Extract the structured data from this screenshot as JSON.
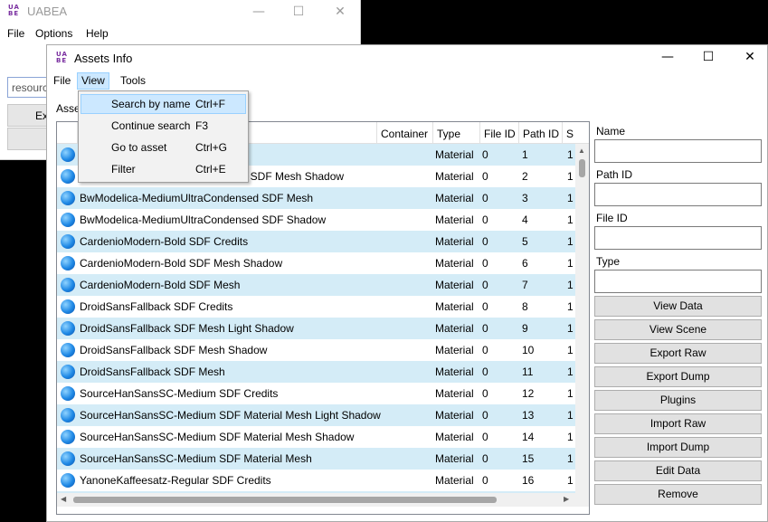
{
  "bg_window": {
    "title": "UABEA",
    "logo": "UA BE",
    "menu": [
      "File",
      "Options",
      "Help"
    ],
    "input_value": "resourc",
    "buttons": [
      "Ex",
      ""
    ],
    "min_icon": "—",
    "max_icon": "☐",
    "close_icon": "✕"
  },
  "window": {
    "title": "Assets Info",
    "logo": "UA BE",
    "min_icon": "—",
    "max_icon": "☐",
    "close_icon": "✕",
    "menu": {
      "file": "File",
      "view": "View",
      "tools": "Tools"
    },
    "assets_label": "Asse"
  },
  "view_menu": {
    "items": [
      {
        "label": "Search by name",
        "shortcut": "Ctrl+F"
      },
      {
        "label": "Continue search",
        "shortcut": "F3"
      },
      {
        "label": "Go to asset",
        "shortcut": "Ctrl+G"
      },
      {
        "label": "Filter",
        "shortcut": "Ctrl+E"
      }
    ]
  },
  "table": {
    "columns": {
      "container": "Container",
      "type": "Type",
      "file_id": "File ID",
      "path_id": "Path ID",
      "size": "S"
    },
    "rows": [
      {
        "name": "",
        "type": "Material",
        "file_id": "0",
        "path_id": "1",
        "size": "1"
      },
      {
        "name": "ed SDF Mesh Shadow",
        "type": "Material",
        "file_id": "0",
        "path_id": "2",
        "size": "1"
      },
      {
        "name": "BwModelica-MediumUltraCondensed SDF Mesh",
        "type": "Material",
        "file_id": "0",
        "path_id": "3",
        "size": "1"
      },
      {
        "name": "BwModelica-MediumUltraCondensed SDF Shadow",
        "type": "Material",
        "file_id": "0",
        "path_id": "4",
        "size": "1"
      },
      {
        "name": "CardenioModern-Bold SDF Credits",
        "type": "Material",
        "file_id": "0",
        "path_id": "5",
        "size": "1"
      },
      {
        "name": "CardenioModern-Bold SDF Mesh Shadow",
        "type": "Material",
        "file_id": "0",
        "path_id": "6",
        "size": "1"
      },
      {
        "name": "CardenioModern-Bold SDF Mesh",
        "type": "Material",
        "file_id": "0",
        "path_id": "7",
        "size": "1"
      },
      {
        "name": "DroidSansFallback SDF Credits",
        "type": "Material",
        "file_id": "0",
        "path_id": "8",
        "size": "1"
      },
      {
        "name": "DroidSansFallback SDF Mesh Light Shadow",
        "type": "Material",
        "file_id": "0",
        "path_id": "9",
        "size": "1"
      },
      {
        "name": "DroidSansFallback SDF Mesh Shadow",
        "type": "Material",
        "file_id": "0",
        "path_id": "10",
        "size": "1"
      },
      {
        "name": "DroidSansFallback SDF Mesh",
        "type": "Material",
        "file_id": "0",
        "path_id": "11",
        "size": "1"
      },
      {
        "name": "SourceHanSansSC-Medium SDF Credits",
        "type": "Material",
        "file_id": "0",
        "path_id": "12",
        "size": "1"
      },
      {
        "name": "SourceHanSansSC-Medium SDF Material Mesh Light Shadow",
        "type": "Material",
        "file_id": "0",
        "path_id": "13",
        "size": "1"
      },
      {
        "name": "SourceHanSansSC-Medium SDF Material Mesh Shadow",
        "type": "Material",
        "file_id": "0",
        "path_id": "14",
        "size": "1"
      },
      {
        "name": "SourceHanSansSC-Medium SDF Material Mesh",
        "type": "Material",
        "file_id": "0",
        "path_id": "15",
        "size": "1"
      },
      {
        "name": "YanoneKaffeesatz-Regular SDF Credits",
        "type": "Material",
        "file_id": "0",
        "path_id": "16",
        "size": "1"
      },
      {
        "name": "",
        "type": "",
        "file_id": "",
        "path_id": "",
        "size": ""
      }
    ],
    "scroll_up": "▲",
    "scroll_left": "◀",
    "scroll_right": "▶"
  },
  "panel": {
    "name_label": "Name",
    "path_id_label": "Path ID",
    "file_id_label": "File ID",
    "type_label": "Type",
    "buttons": {
      "view_data": "View Data",
      "view_scene": "View Scene",
      "export_raw": "Export Raw",
      "export_dump": "Export Dump",
      "plugins": "Plugins",
      "import_raw": "Import Raw",
      "import_dump": "Import Dump",
      "edit_data": "Edit Data",
      "remove": "Remove"
    }
  }
}
